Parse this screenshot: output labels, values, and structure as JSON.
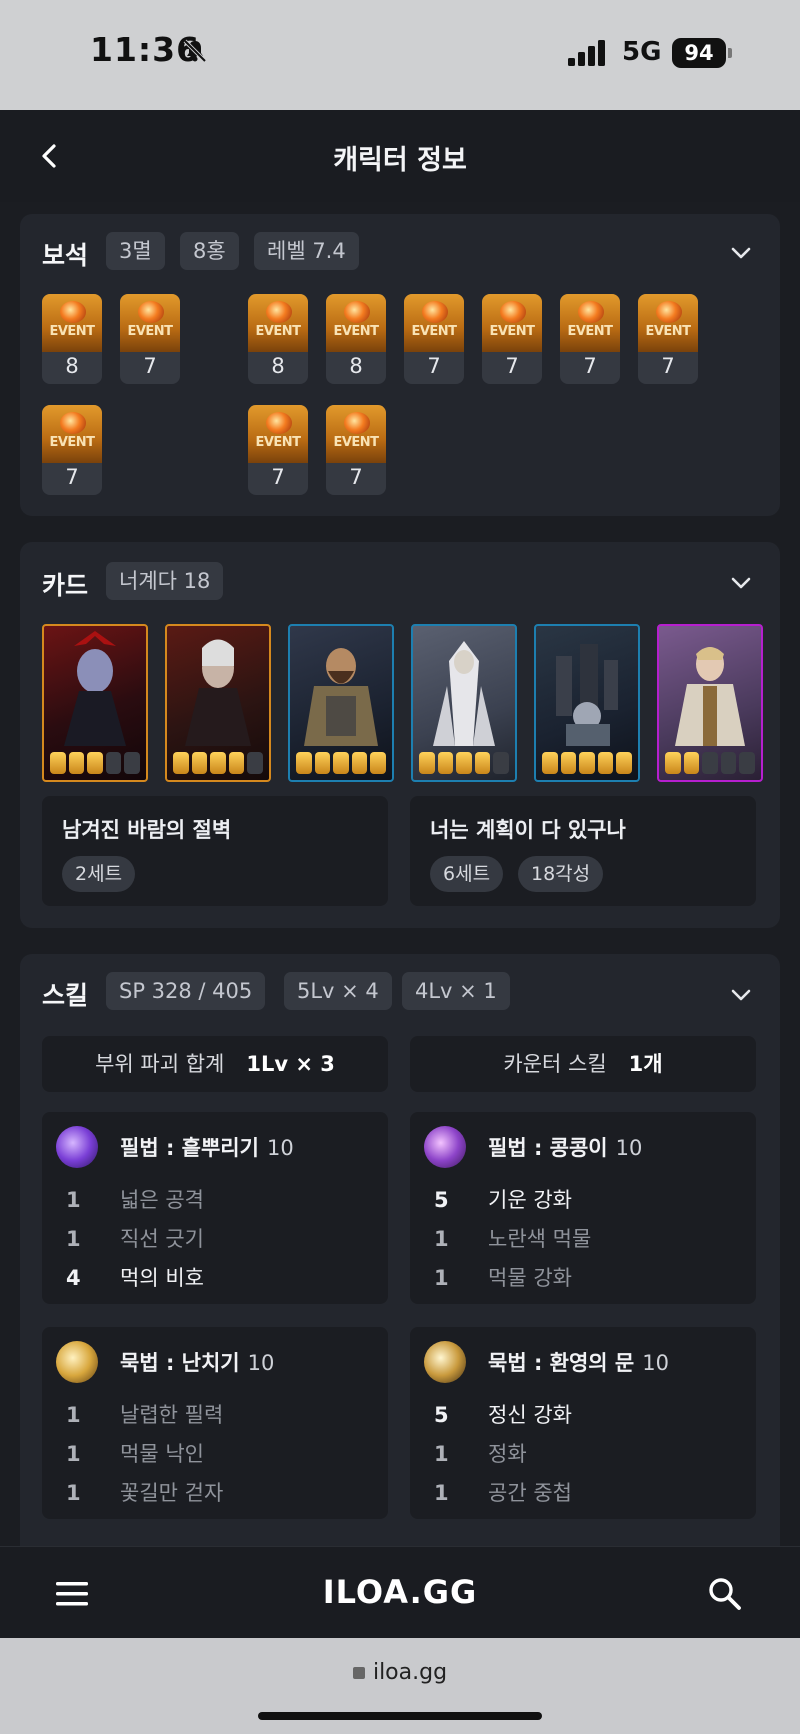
{
  "status": {
    "time": "11:36",
    "network": "5G",
    "battery": "94"
  },
  "nav": {
    "title": "캐릭터 정보"
  },
  "gems": {
    "title": "보석",
    "chips": [
      "3멸",
      "8홍",
      "레벨 7.4"
    ],
    "event_label": "EVENT",
    "levels_row1": [
      "8",
      "7",
      "8",
      "8",
      "7",
      "7",
      "7",
      "7"
    ],
    "levels_row2": [
      "7",
      "7",
      "7"
    ]
  },
  "cards": {
    "title": "카드",
    "chip": "너계다 18",
    "sets": [
      {
        "name": "남겨진 바람의 절벽",
        "chips": [
          "2세트"
        ]
      },
      {
        "name": "너는 계획이 다 있구나",
        "chips": [
          "6세트",
          "18각성"
        ]
      }
    ],
    "awakening": [
      3,
      4,
      5,
      4,
      5,
      2
    ]
  },
  "skills": {
    "title": "스킬",
    "chips": [
      "SP 328 / 405",
      "5Lv × 4",
      "4Lv × 1"
    ],
    "stats": [
      {
        "label": "부위 파괴 합계",
        "value": "1Lv × 3"
      },
      {
        "label": "카운터 스킬",
        "value": "1개"
      }
    ],
    "list": [
      {
        "name": "필법 : 흩뿌리기",
        "level": "10",
        "tripods": [
          {
            "lv": "1",
            "name": "넓은 공격"
          },
          {
            "lv": "1",
            "name": "직선 긋기"
          },
          {
            "lv": "4",
            "name": "먹의 비호"
          }
        ]
      },
      {
        "name": "필법 : 콩콩이",
        "level": "10",
        "tripods": [
          {
            "lv": "5",
            "name": "기운 강화"
          },
          {
            "lv": "1",
            "name": "노란색 먹물"
          },
          {
            "lv": "1",
            "name": "먹물 강화"
          }
        ]
      },
      {
        "name": "묵법 : 난치기",
        "level": "10",
        "tripods": [
          {
            "lv": "1",
            "name": "날렵한 필력"
          },
          {
            "lv": "1",
            "name": "먹물 낙인"
          },
          {
            "lv": "1",
            "name": "꽃길만 걷자"
          }
        ]
      },
      {
        "name": "묵법 : 환영의 문",
        "level": "10",
        "tripods": [
          {
            "lv": "5",
            "name": "정신 강화"
          },
          {
            "lv": "1",
            "name": "정화"
          },
          {
            "lv": "1",
            "name": "공간 중첩"
          }
        ]
      }
    ]
  },
  "bottom": {
    "logo": "ILOA.GG"
  },
  "browser": {
    "url": "iloa.gg"
  }
}
